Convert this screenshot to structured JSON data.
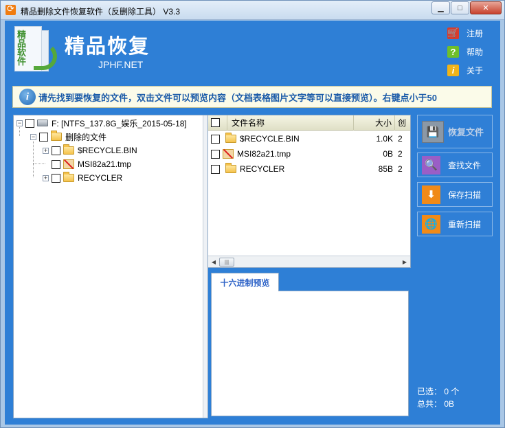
{
  "window": {
    "title": "精品删除文件恢复软件（反删除工具） V3.3",
    "min_label": "▁",
    "max_label": "□",
    "close_label": "✕"
  },
  "brand": {
    "logo_text": "精品软件",
    "title": "精品恢复",
    "url": "JPHF.NET"
  },
  "top_links": [
    {
      "label": "注册",
      "icon": "cart-icon",
      "glyph": "🛒"
    },
    {
      "label": "帮助",
      "icon": "help-icon",
      "glyph": "?"
    },
    {
      "label": "关于",
      "icon": "about-icon",
      "glyph": "i"
    }
  ],
  "notice": {
    "icon_glyph": "i",
    "text": "请先找到要恢复的文件，双击文件可以预览内容（文档表格图片文字等可以直接预览）。右键点小于50"
  },
  "tree": {
    "root": "F:  [NTFS_137.8G_娱乐_2015-05-18]",
    "deleted": "删除的文件",
    "children": [
      "$RECYCLE.BIN",
      "MSI82a21.tmp",
      "RECYCLER"
    ],
    "expander_plus": "+",
    "expander_minus": "−"
  },
  "filelist": {
    "columns": [
      "文件名称",
      "大小",
      "创"
    ],
    "rows": [
      {
        "name": "$RECYCLE.BIN",
        "size": "1.0K",
        "date": "2",
        "type": "folder"
      },
      {
        "name": "MSI82a21.tmp",
        "size": "0B",
        "date": "2",
        "type": "deleted"
      },
      {
        "name": "RECYCLER",
        "size": "85B",
        "date": "2",
        "type": "folder"
      }
    ],
    "scroll_left": "◀",
    "scroll_right": "▶",
    "thumb": "|||"
  },
  "preview": {
    "tab_label": "十六进制预览"
  },
  "actions": [
    {
      "label": "恢复文件",
      "glyph": "💾",
      "enabled": false
    },
    {
      "label": "查找文件",
      "glyph": "🔍",
      "enabled": true
    },
    {
      "label": "保存扫描",
      "glyph": "⬇",
      "enabled": true
    },
    {
      "label": "重新扫描",
      "glyph": "🌐",
      "enabled": true
    }
  ],
  "status": {
    "selected": "已选：  0 个",
    "total": "总共：  0B"
  },
  "colors": {
    "main_bg": "#2e7fd6",
    "notice_text": "#1a5aa8",
    "header_bg": "#e0e0c6"
  }
}
